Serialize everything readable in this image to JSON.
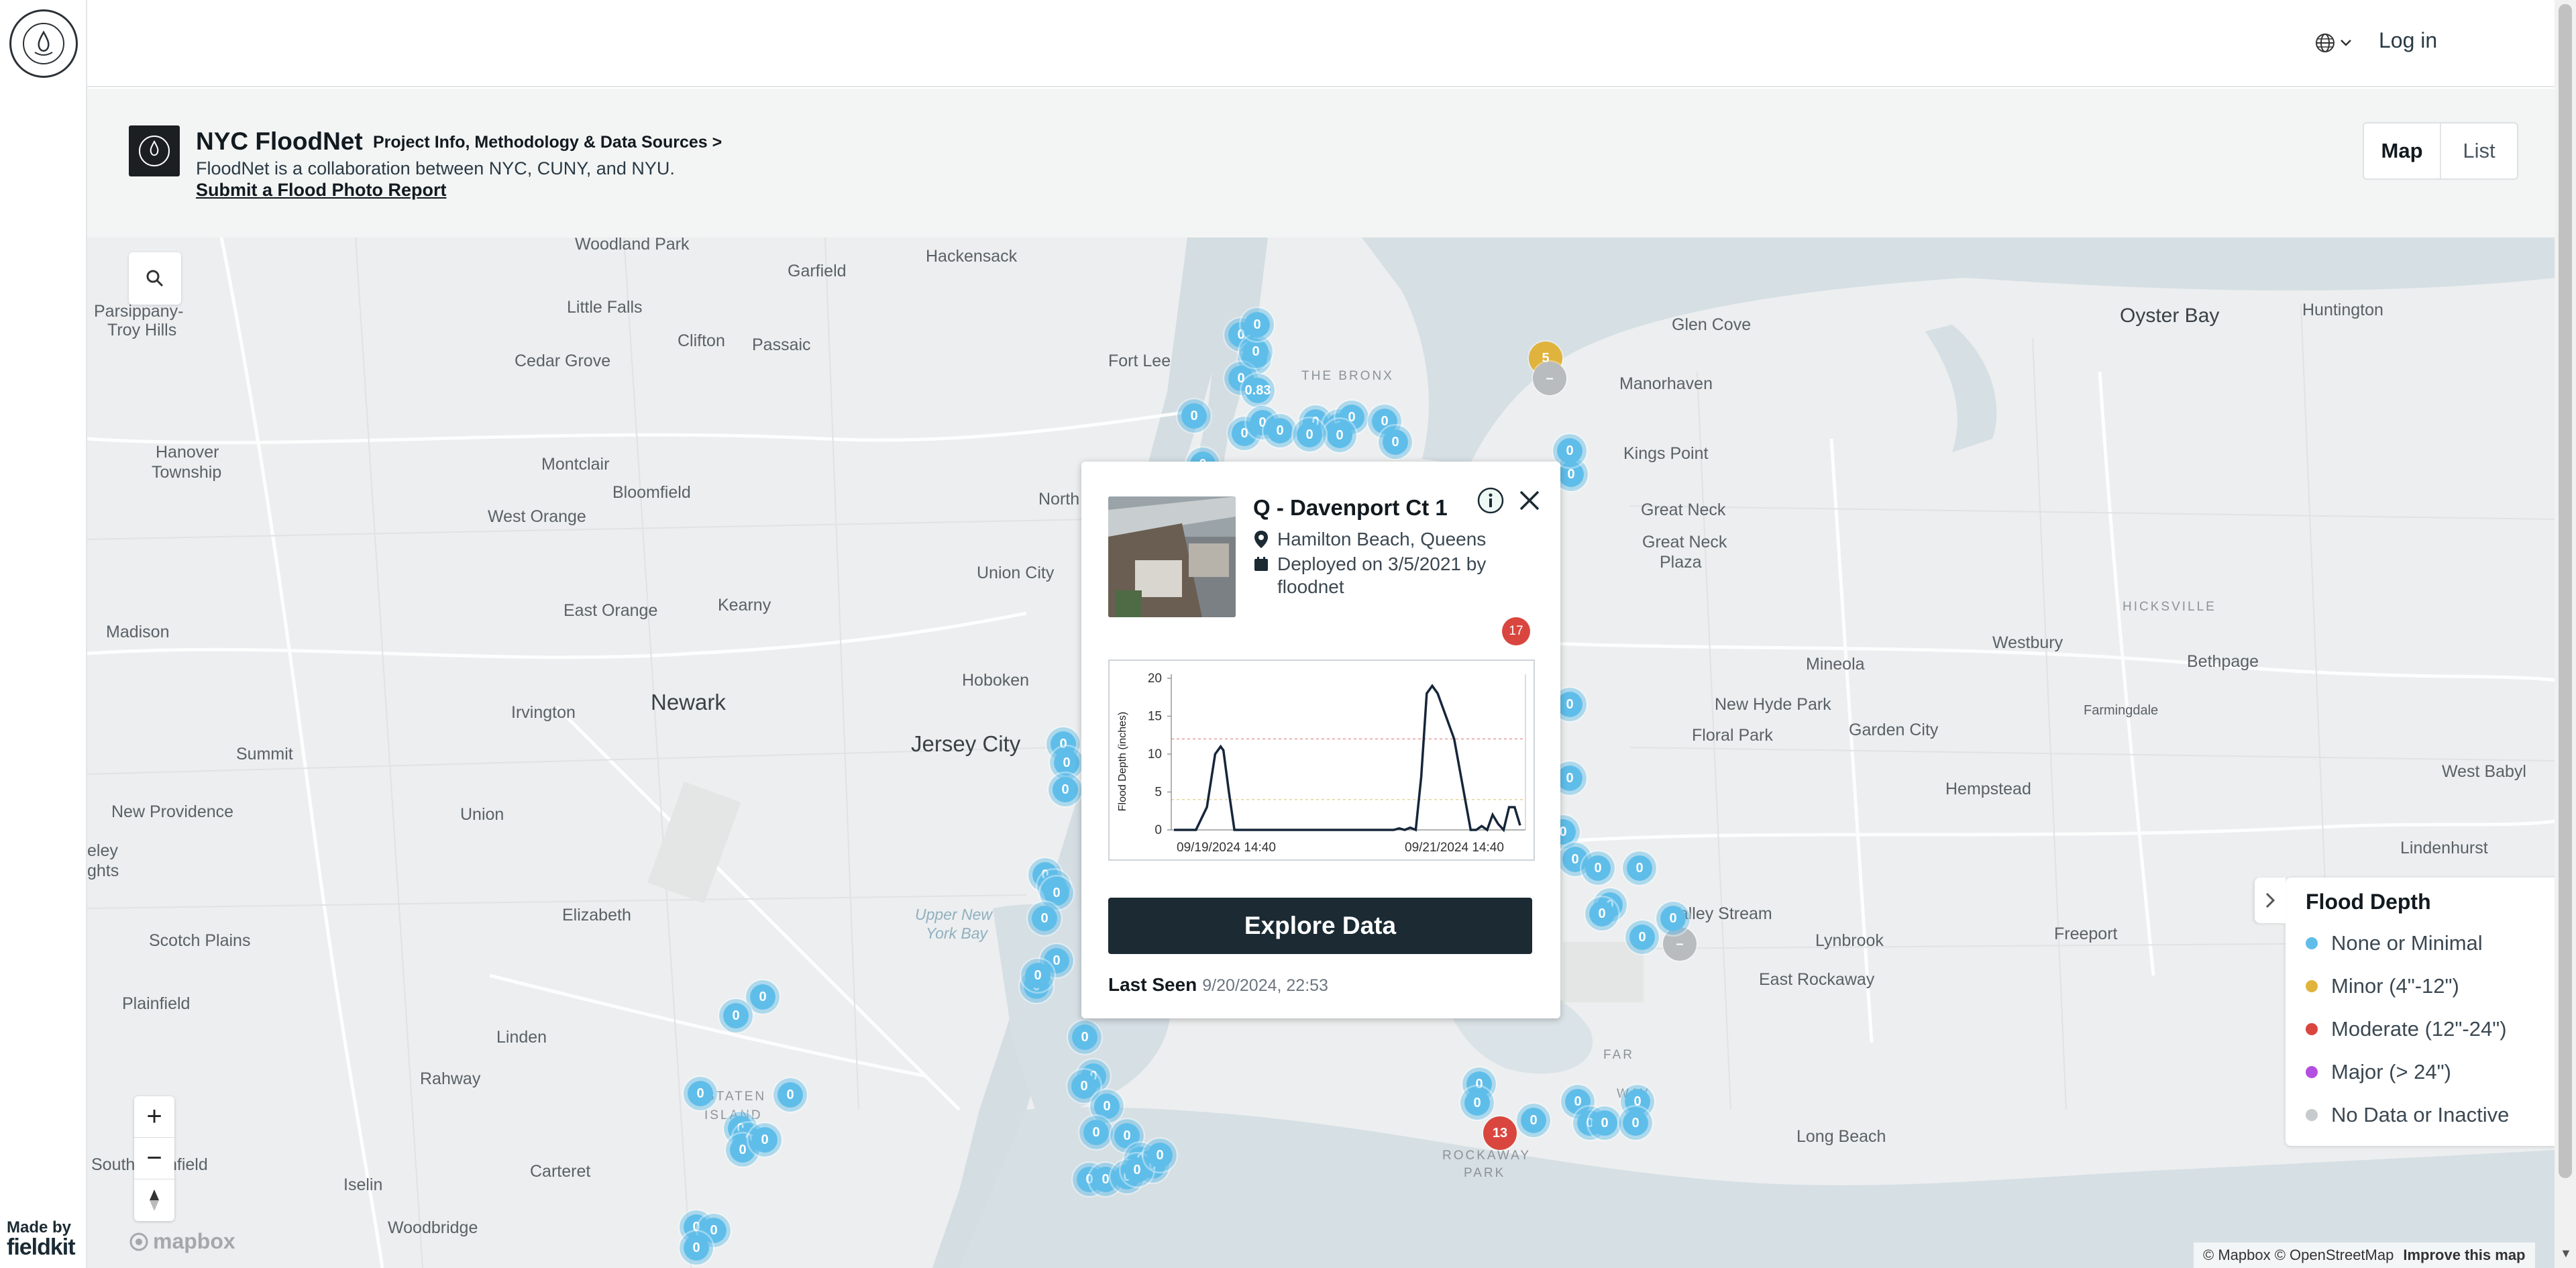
{
  "header": {
    "login_label": "Log in",
    "language_icon": "globe-icon"
  },
  "project": {
    "title": "NYC FloodNet",
    "info_link": "Project Info, Methodology & Data Sources >",
    "description": "FloodNet is a collaboration between NYC, CUNY, and NYU.",
    "report_link": "Submit a Flood Photo Report"
  },
  "view_toggle": {
    "map_label": "Map",
    "list_label": "List",
    "selected": "Map"
  },
  "map": {
    "places": {
      "woodland_park": "Woodland Park",
      "hackensack": "Hackensack",
      "garfield": "Garfield",
      "parsippany": "Parsippany-",
      "troy_hills": "Troy Hills",
      "little_falls": "Little Falls",
      "clifton": "Clifton",
      "passaic": "Passaic",
      "cedar_grove": "Cedar Grove",
      "fort_lee": "Fort Lee",
      "the_bronx": "THE BRONX",
      "hanover": "Hanover",
      "township": "Township",
      "montclair": "Montclair",
      "bloomfield": "Bloomfield",
      "north_bergen": "North Bergen",
      "west_orange": "West Orange",
      "union_city": "Union City",
      "east_orange": "East Orange",
      "kearny": "Kearny",
      "madison": "Madison",
      "hoboken": "Hoboken",
      "irvington": "Irvington",
      "newark": "Newark",
      "jersey_city": "Jersey City",
      "summit": "Summit",
      "new_providence": "New Providence",
      "union": "Union",
      "berkeley_heights": "eley",
      "berkeley_heights2": "ghts",
      "elizabeth": "Elizabeth",
      "upper_ny_bay": "Upper New",
      "upper_ny_bay2": "York Bay",
      "scotch_plains": "Scotch Plains",
      "plainfield": "Plainfield",
      "linden": "Linden",
      "rahway": "Rahway",
      "staten": "STATEN",
      "island": "ISLAND",
      "south_plainfield": "South Plainfield",
      "carteret": "Carteret",
      "iselin": "Iselin",
      "woodbridge": "Woodbridge",
      "glen_cove": "Glen Cove",
      "oyster_bay": "Oyster Bay",
      "huntington": "Huntington",
      "manorhaven": "Manorhaven",
      "kings_point": "Kings Point",
      "great_neck": "Great Neck",
      "great_neck_plaza": "Great Neck",
      "great_neck_plaza2": "Plaza",
      "hicksville": "HICKSVILLE",
      "westbury": "Westbury",
      "bethpage": "Bethpage",
      "mineola": "Mineola",
      "new_hyde_park": "New Hyde Park",
      "farmingdale": "Farmingdale",
      "floral_park": "Floral Park",
      "garden_city": "Garden City",
      "west_babylon": "West Babyl",
      "hempstead": "Hempstead",
      "lindenhurst": "Lindenhurst",
      "valley_stream": "Valley Stream",
      "lynbrook": "Lynbrook",
      "freeport": "Freeport",
      "east_rockaway": "East Rockaway",
      "far_rockaway": "FAR",
      "far_rockaway2": "WAY",
      "long_beach": "Long Beach",
      "rockaway_park": "ROCKAWAY",
      "rockaway_park2": "PARK"
    },
    "search_icon": "search-icon",
    "zoom_in": "+",
    "zoom_out": "−",
    "compass_icon": "compass-icon",
    "mapbox_logo": "mapbox",
    "attribution": "© Mapbox © OpenStreetMap",
    "improve_link": "Improve this map"
  },
  "markers": [
    {
      "label": "0.83",
      "status": "none"
    },
    {
      "label": "5",
      "status": "minor"
    },
    {
      "label": "13",
      "status": "moderate"
    },
    {
      "label": "–",
      "status": "nodata"
    },
    {
      "label": "0",
      "status": "none"
    }
  ],
  "legend": {
    "title": "Flood Depth",
    "items": [
      {
        "label": "None or Minimal",
        "color": "#5fbde9"
      },
      {
        "label": "Minor (4\"-12\")",
        "color": "#e0b33c"
      },
      {
        "label": "Moderate (12\"-24\")",
        "color": "#d9463f"
      },
      {
        "label": "Major (> 24\")",
        "color": "#b44ee0"
      },
      {
        "label": "No Data or Inactive",
        "color": "#c8cbcd"
      }
    ]
  },
  "popup": {
    "title": "Q - Davenport Ct 1",
    "location": "Hamilton Beach, Queens",
    "deployed": "Deployed on 3/5/2021 by floodnet",
    "badge": "17",
    "explore_label": "Explore Data",
    "last_seen_label": "Last Seen",
    "last_seen_value": "9/20/2024, 22:53",
    "info_icon": "info-icon",
    "close_icon": "close-icon"
  },
  "chart_data": {
    "type": "line",
    "ylabel": "Flood Depth (inches)",
    "xlabel": "",
    "ylim": [
      0,
      20
    ],
    "yticks": [
      "20",
      "15",
      "10",
      "5",
      "0"
    ],
    "xticks": [
      "09/19/2024 14:40",
      "09/21/2024 14:40"
    ],
    "threshold_lines": [
      4,
      12
    ],
    "series": [
      {
        "x": [
          0,
          4,
          6,
          7.5,
          8.5,
          9,
          10,
          11,
          30,
          40,
          41,
          42,
          43,
          44,
          45,
          46,
          47,
          48,
          49,
          50,
          51,
          52,
          53,
          54,
          55,
          56,
          57,
          58,
          59,
          60,
          61,
          62,
          63
        ],
        "y": [
          0,
          0,
          3,
          10,
          11,
          10.5,
          5,
          0,
          0,
          0,
          0.2,
          0,
          0.3,
          0,
          7,
          18,
          19,
          18,
          16,
          14,
          12,
          8,
          4,
          0,
          0,
          0.5,
          0,
          2,
          0.8,
          0,
          3,
          3,
          0.6
        ]
      }
    ]
  }
}
